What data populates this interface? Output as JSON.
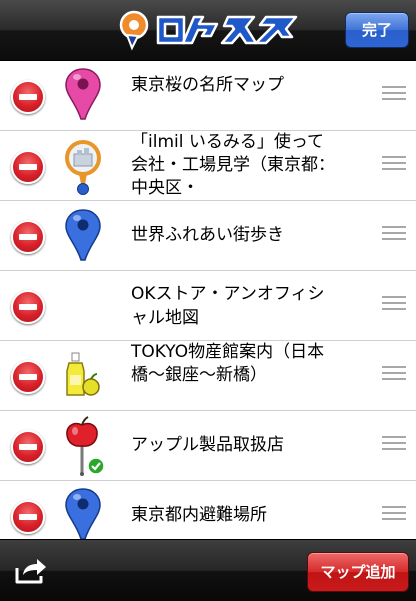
{
  "header": {
    "logo_text": "ロケスマ",
    "done_label": "完了"
  },
  "maps": [
    {
      "title": "東京桜の名所マップ",
      "icon": "pink-map-pin-icon"
    },
    {
      "title": "「ilmil いるみる」使って会社・工場見学（東京都：中央区・",
      "icon": "magnifier-building-icon"
    },
    {
      "title": "世界ふれあい街歩き",
      "icon": "blue-map-pin-icon"
    },
    {
      "title": "OKストア・アンオフィシャル地図",
      "icon": ""
    },
    {
      "title": "TOKYO物産館案内（日本橋〜銀座〜新橋）",
      "icon": "bottle-apple-icon"
    },
    {
      "title": "アップル製品取扱店",
      "icon": "apple-pin-check-icon"
    },
    {
      "title": "東京都内避難場所",
      "icon": "blue-map-pin-icon"
    }
  ],
  "toolbar": {
    "share_icon": "share-icon",
    "add_map_label": "マップ追加"
  },
  "colors": {
    "delete_red": "#d8202a",
    "done_blue": "#3f73d6",
    "add_red": "#d52a2a"
  }
}
